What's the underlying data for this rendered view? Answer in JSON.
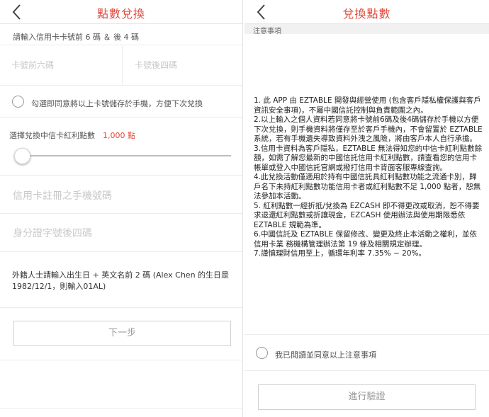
{
  "left": {
    "title": "點數兌換",
    "card_instruction": "請輸入信用卡卡號前 6 碼 ＆ 後 4 碼",
    "card_first_placeholder": "卡號前六碼",
    "card_last_placeholder": "卡號後四碼",
    "save_card_label": "勾選即同意將以上卡號儲存於手機，方便下次兌換",
    "points_label": "選擇兌換中信卡紅利點數",
    "points_value": "1,000 點",
    "slider_fraction": 0,
    "phone_placeholder": "信用卡註冊之手機號碼",
    "id_placeholder": "身分證字號後四碼",
    "foreign_note": "外籍人士請輸入出生日 + 英文名前 2 碼 (Alex Chen 的生日是 1982/12/1，則輸入01AL)",
    "next_button": "下一步"
  },
  "right": {
    "title": "兌換點數",
    "notice_title": "注意事項",
    "terms": [
      "1. 此 APP 由 EZTABLE 開發與經營使用 (包含客戶隱私權保護與客戶資訊安全事項)，不屬中國信託控制與負責範圍之內。",
      "2.以上輸入之個人資料若同意將卡號前6碼及後4碼儲存於手機以方便下次兌換，則手機資料將僅存至於客戶手機內，不會留置於 EZTABLE 系統，若有手機遺失導致資料外洩之風險，將由客戶本人自行承擔。",
      "3.信用卡資料為客戶隱私，EZTABLE 無法得知您的中信卡紅利點數餘額，如需了解您最新的中國信託信用卡紅利點數，請查看您的信用卡帳單或登入中國信託官網或撥打信用卡背面客服專線查詢。",
      "4.此兌換活動僅適用於持有中國信託具紅利點數功能之流通卡別，歸戶名下未持紅利點數功能信用卡者或紅利點數不足 1,000 點者，恕無法參加本活動。",
      "5. 紅利點數一經折抵/兌換為 EZCASH 即不得更改或取消，恕不得要求退還紅利點數或折讓現金，EZCASH 使用辦法與使用期限悉依 EZTABLE 規範為準。",
      "6.中國信託及 EZTABLE 保留修改、變更及終止本活動之權利，並依信用卡業 務機構管理辦法第 19 條及相關規定辦理。",
      "7.謹慎理財信用至上，循環年利率 7.35% ~ 20%。"
    ],
    "agree_label": "我已閱讀並同意以上注意事項",
    "verify_button": "進行驗證"
  },
  "colors": {
    "accent": "#e0483b",
    "placeholder": "#c8c8c8",
    "divider": "#ececec"
  },
  "icons": {
    "back": "chevron-left-icon"
  }
}
